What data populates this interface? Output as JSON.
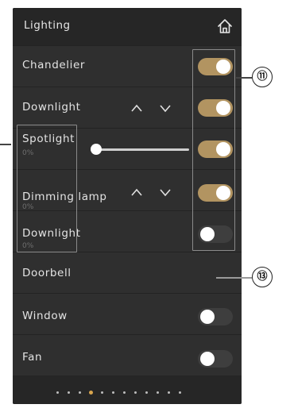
{
  "header": {
    "title": "Lighting",
    "home_icon": "home-icon"
  },
  "rows": [
    {
      "label": "Chandelier",
      "state": "on"
    },
    {
      "label": "Downlight",
      "state": "on",
      "controls": [
        "chevron-up-icon",
        "chevron-down-icon"
      ]
    },
    {
      "label": "Spotlight",
      "sub": "0%",
      "state": "on",
      "slider_value": 0
    },
    {
      "label": "Dimming lamp",
      "sub": "0%",
      "state": "on",
      "controls": [
        "chevron-up-icon",
        "chevron-down-icon"
      ]
    },
    {
      "label": "Downlight",
      "sub": "0%",
      "state": "off"
    },
    {
      "label": "Doorbell"
    },
    {
      "label": "Window",
      "state": "off"
    },
    {
      "label": "Fan",
      "state": "off"
    }
  ],
  "pagination": {
    "total": 12,
    "active_index": 3
  },
  "callouts": {
    "toggles": "⑪",
    "doorbell": "⑬"
  },
  "colors": {
    "toggle_on": "#b29461",
    "toggle_off": "#3e3e3e",
    "panel_bg": "#2f2f2f",
    "active_dot": "#d9a64e"
  }
}
